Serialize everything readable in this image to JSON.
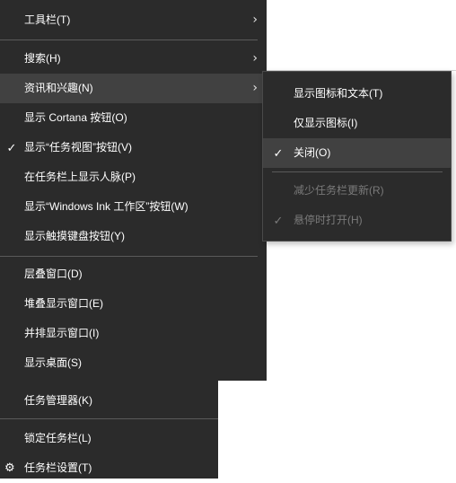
{
  "main_menu": {
    "toolbars": "工具栏(T)",
    "search": "搜索(H)",
    "news_interests": "资讯和兴趣(N)",
    "show_cortana": "显示 Cortana 按钮(O)",
    "show_task_view": "显示“任务视图”按钮(V)",
    "show_people": "在任务栏上显示人脉(P)",
    "show_ink_workspace": "显示“Windows Ink 工作区”按钮(W)",
    "show_touch_keyboard": "显示触摸键盘按钮(Y)",
    "cascade_windows": "层叠窗口(D)",
    "stack_windows": "堆叠显示窗口(E)",
    "side_by_side": "并排显示窗口(I)",
    "show_desktop": "显示桌面(S)"
  },
  "bottom_menu": {
    "task_manager": "任务管理器(K)",
    "lock_taskbar": "锁定任务栏(L)",
    "taskbar_settings": "任务栏设置(T)"
  },
  "sub_menu": {
    "show_icon_text": "显示图标和文本(T)",
    "show_icon_only": "仅显示图标(I)",
    "turn_off": "关闭(O)",
    "reduce_updates": "减少任务栏更新(R)",
    "open_on_hover": "悬停时打开(H)"
  },
  "icons": {
    "check": "✓",
    "arrow": "›",
    "gear": "⚙"
  },
  "colors": {
    "menu_bg": "#2b2b2b",
    "hover_bg": "#414141",
    "disabled_text": "#7a7a7a",
    "separator": "#5a5a5a"
  }
}
